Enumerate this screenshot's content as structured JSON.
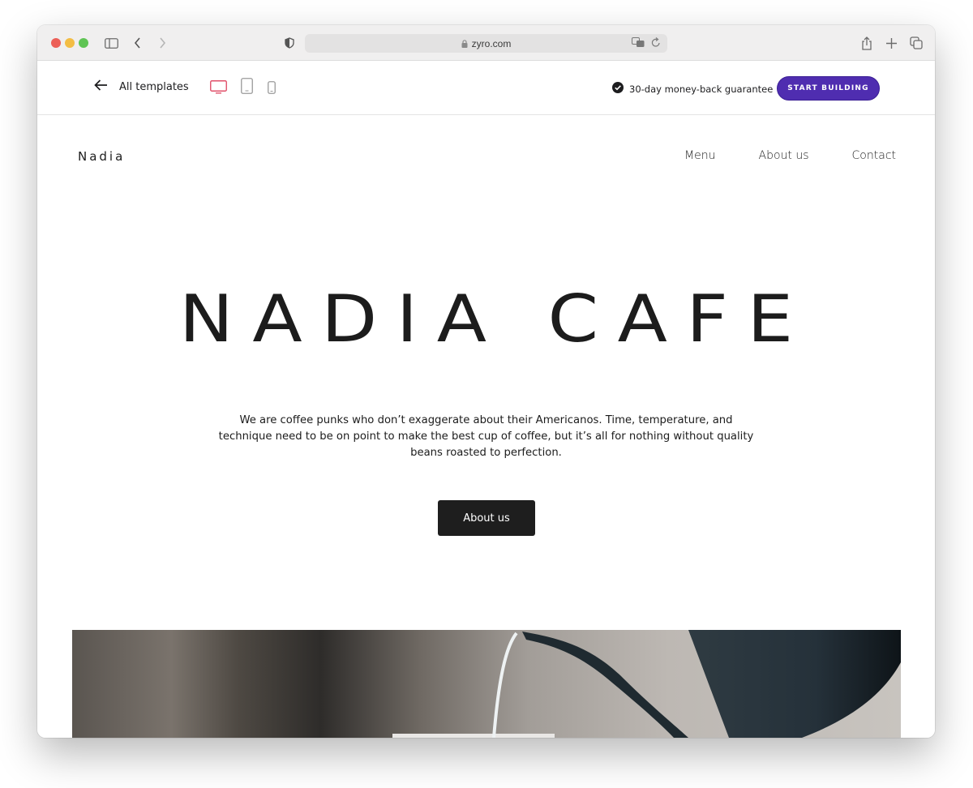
{
  "browser": {
    "url": "zyro.com",
    "icons": [
      "sidebar-icon",
      "back-icon",
      "forward-icon",
      "privacy-shield-icon",
      "lock-icon",
      "translate-icon",
      "reload-icon",
      "share-icon",
      "new-tab-icon",
      "tabs-overview-icon"
    ]
  },
  "zyro_bar": {
    "back_label": "All templates",
    "devices": [
      "desktop",
      "tablet",
      "mobile"
    ],
    "active_device": "desktop",
    "guarantee": "30-day money-back guarantee",
    "start_button": "START BUILDING",
    "accent_color": "#4f2db0",
    "active_device_color": "#e0506a"
  },
  "site": {
    "logo": "Nadia",
    "nav": [
      "Menu",
      "About us",
      "Contact"
    ],
    "hero_title": "NADIA CAFE",
    "hero_text": "We are coffee punks who don’t exaggerate about their Americanos. Time, temperature, and technique need to be on point to make the best cup of coffee, but it’s all for nothing without quality beans roasted to perfection.",
    "hero_button": "About us",
    "hero_image_alt": "Water pouring from a kettle into a coffee cup"
  }
}
